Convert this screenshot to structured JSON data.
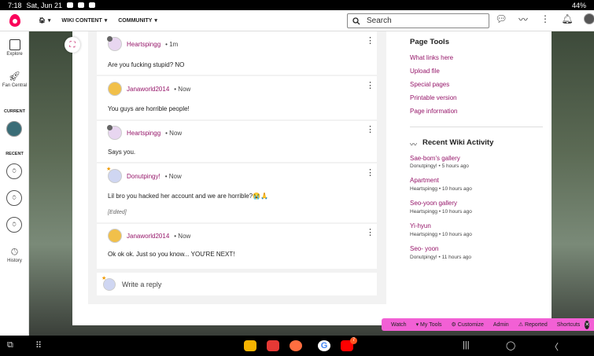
{
  "statusbar": {
    "time": "7:18",
    "date": "Sat, Jun 21",
    "battery": "44%"
  },
  "topnav": {
    "wiki_content": "WIKI CONTENT",
    "community": "COMMUNITY",
    "search_placeholder": "Search"
  },
  "sidebar": {
    "explore": "Explore",
    "fan_central": "Fan Central",
    "current": "CURRENT",
    "recent": "RECENT",
    "history": "History"
  },
  "replies": [
    {
      "user": "Heartspingg",
      "time": "1m",
      "text": "Are you fucking stupid? NO",
      "edited": ""
    },
    {
      "user": "Janaworld2014",
      "time": "Now",
      "text": "You guys are horrible people!",
      "edited": ""
    },
    {
      "user": "Heartspingg",
      "time": "Now",
      "text": "Says you.",
      "edited": ""
    },
    {
      "user": "Donutpingy!",
      "time": "Now",
      "text": "Lil bro you hacked her account and we are horrible?😭🙏",
      "edited": "[Edited]"
    },
    {
      "user": "Janaworld2014",
      "time": "Now",
      "text": "Ok ok ok. Just so you know... YOU'RE NEXT!",
      "edited": ""
    }
  ],
  "write_reply": "Write a reply",
  "page_tools": {
    "title": "Page Tools",
    "links": [
      "What links here",
      "Upload file",
      "Special pages",
      "Printable version",
      "Page information"
    ]
  },
  "activity": {
    "title": "Recent Wiki Activity",
    "items": [
      {
        "title": "Sae-bom's gallery",
        "meta": "Donutpingy! • 5 hours ago"
      },
      {
        "title": "Apartment",
        "meta": "Heartspingg • 10 hours ago"
      },
      {
        "title": "Seo-yoon gallery",
        "meta": "Heartspingg • 10 hours ago"
      },
      {
        "title": "Yi-hyun",
        "meta": "Heartspingg • 10 hours ago"
      },
      {
        "title": "Seo- yoon",
        "meta": "Donutpingy! • 11 hours ago"
      }
    ]
  },
  "toolbar": {
    "watch": "Watch",
    "my_tools": "My Tools",
    "customize": "Customize",
    "admin": "Admin",
    "reported": "Reported",
    "shortcuts": "Shortcuts"
  },
  "navbar": {
    "youtube_badge": "7"
  },
  "colors": {
    "accent": "#96176a",
    "toolbar": "#f260d5",
    "brand": "#fa005a"
  }
}
